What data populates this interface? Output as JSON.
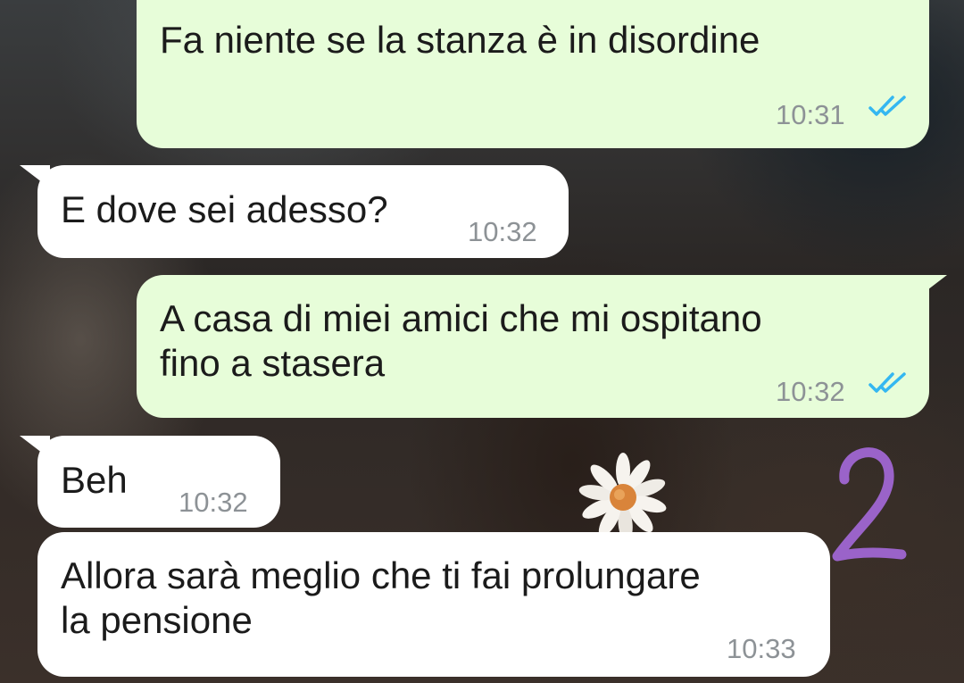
{
  "messages": [
    {
      "text": "Fa niente se la stanza è in disordine",
      "time": "10:31",
      "direction": "outgoing",
      "status": "read"
    },
    {
      "text": "E dove sei adesso?",
      "time": "10:32",
      "direction": "incoming"
    },
    {
      "text": "A casa di miei amici che mi ospitano\nfino a stasera",
      "time": "10:32",
      "direction": "outgoing",
      "status": "read"
    },
    {
      "text": "Beh",
      "time": "10:32",
      "direction": "incoming"
    },
    {
      "text": "Allora sarà meglio che ti fai prolungare\nla pensione",
      "time": "10:33",
      "direction": "incoming"
    }
  ],
  "annotation": {
    "number": "2",
    "color": "#9a63c9"
  },
  "colors": {
    "outgoing_bubble": "#e7fdd9",
    "incoming_bubble": "#ffffff",
    "timestamp": "#8d9296",
    "read_ticks": "#34b7f1"
  },
  "icons": {
    "read_receipt": "double-check-icon",
    "sticker": "daisy-icon"
  }
}
